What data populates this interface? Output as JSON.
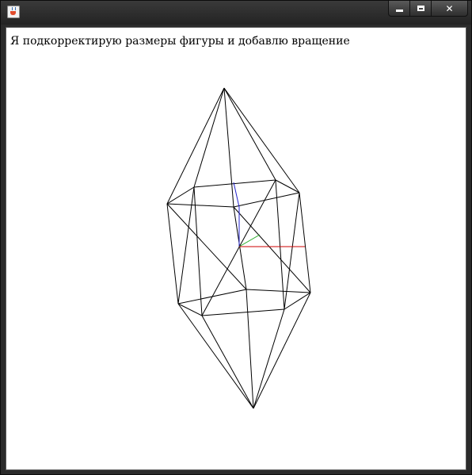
{
  "window": {
    "title": "",
    "controls": {
      "minimize_icon": "minimize-icon",
      "maximize_icon": "maximize-icon",
      "close_icon": "close-icon",
      "close_glyph": "✕"
    }
  },
  "canvas": {
    "caption": "Я подкорректирую размеры фигуры и добавлю вращение"
  },
  "colors": {
    "wireframe": "#000000",
    "axis_x": "#cc0000",
    "axis_y": "#2222cc",
    "axis_z": "#22aa22",
    "canvas_bg": "#ffffff",
    "frame": "#2b2b2b"
  }
}
